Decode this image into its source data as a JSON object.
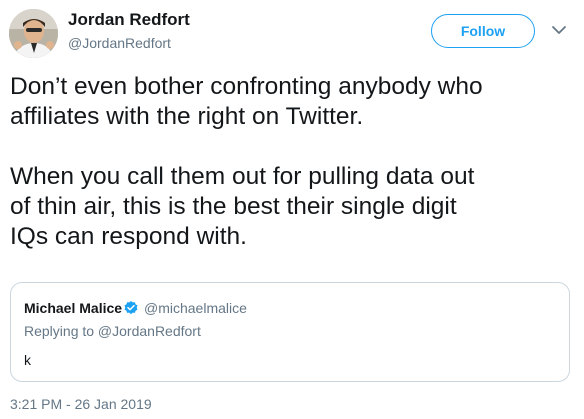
{
  "author": {
    "name": "Jordan Redfort",
    "handle": "@JordanRedfort"
  },
  "actions": {
    "follow_label": "Follow"
  },
  "tweet": {
    "text": "Don’t even bother confronting anybody who\naffiliates with the right on Twitter.\n\nWhen you call them out for pulling data out\nof thin air, this is the best their single digit\nIQs can respond with.",
    "timestamp": "3:21 PM - 26 Jan 2019"
  },
  "quoted_tweet": {
    "name": "Michael Malice",
    "handle": "@michaelmalice",
    "reply_context": "Replying to @JordanRedfort",
    "text": "k",
    "verified": true
  },
  "colors": {
    "accent": "#1da1f2",
    "text_primary": "#14171a",
    "text_secondary": "#657786",
    "border": "#ccd6dd"
  },
  "icons": {
    "avatar": "avatar",
    "menu": "chevron-down-icon",
    "verified": "verified-badge-icon"
  }
}
